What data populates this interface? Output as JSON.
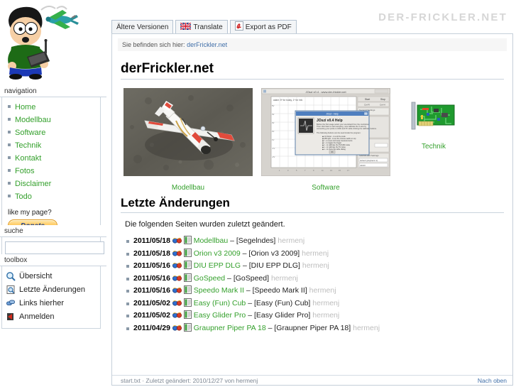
{
  "site": {
    "logo_text": "DER-FRICKLER.NET",
    "accent_green": "#34a02c",
    "link_blue": "#3f6ea8",
    "bullet_gray": "#8a99a8",
    "border_gray": "#c5cfd9"
  },
  "mascot": {
    "alt_name": "cartoon-boy-with-rc-transmitter-and-plane"
  },
  "tabs": [
    {
      "label": "Ältere Versionen",
      "icon": ""
    },
    {
      "label": "Translate",
      "icon": "uk-flag-icon"
    },
    {
      "label": "Export as PDF",
      "icon": "pdf-icon"
    }
  ],
  "breadcrumb": {
    "prefix": "Sie befinden sich hier:",
    "link": "derFrickler.net"
  },
  "page": {
    "title": "derFrickler.net",
    "changes_title": "Letzte Änderungen",
    "changes_intro": "Die folgenden Seiten wurden zuletzt geändert."
  },
  "sidebar": {
    "nav_head": "navigation",
    "nav_items": [
      {
        "label": "Home"
      },
      {
        "label": "Modellbau"
      },
      {
        "label": "Software"
      },
      {
        "label": "Technik"
      },
      {
        "label": "Kontakt"
      },
      {
        "label": "Fotos"
      },
      {
        "label": "Disclaimer"
      },
      {
        "label": "Todo"
      }
    ],
    "donate_prompt": "like my page?",
    "donate_label": "Donate",
    "search_head": "suche",
    "search_value": "",
    "search_placeholder": "",
    "toolbox_head": "toolbox",
    "toolbox_items": [
      {
        "label": "Übersicht",
        "icon": "magnifier-icon"
      },
      {
        "label": "Letzte Änderungen",
        "icon": "document-search-icon"
      },
      {
        "label": "Links hierher",
        "icon": "chain-links-icon"
      },
      {
        "label": "Anmelden",
        "icon": "login-arrow-icon"
      }
    ]
  },
  "thumbnails": [
    {
      "caption": "Modellbau",
      "kind": "rc-plane-photo"
    },
    {
      "caption": "Software",
      "kind": "joszi-screenshot",
      "dialog_title": "JOszi v0.4 Help"
    },
    {
      "caption": "Technik",
      "kind": "circuit-board-icon"
    }
  ],
  "changes": [
    {
      "date": "2011/05/18",
      "page": "Modellbau",
      "summary": "[Segelndes]",
      "author": "hermenj"
    },
    {
      "date": "2011/05/18",
      "page": "Orion v3 2009",
      "summary": "[Orion v3 2009]",
      "author": "hermenj"
    },
    {
      "date": "2011/05/16",
      "page": "DIU EPP DLG",
      "summary": "[DIU EPP DLG]",
      "author": "hermenj"
    },
    {
      "date": "2011/05/16",
      "page": "GoSpeed",
      "summary": "[GoSpeed]",
      "author": "hermenj"
    },
    {
      "date": "2011/05/16",
      "page": "Speedo Mark II",
      "summary": "[Speedo Mark II]",
      "author": "hermenj"
    },
    {
      "date": "2011/05/02",
      "page": "Easy (Fun) Cub",
      "summary": "[Easy (Fun) Cub]",
      "author": "hermenj"
    },
    {
      "date": "2011/05/02",
      "page": "Easy Glider Pro",
      "summary": "[Easy Glider Pro]",
      "author": "hermenj"
    },
    {
      "date": "2011/04/29",
      "page": "Graupner Piper PA 18",
      "summary": "[Graupner Piper PA 18]",
      "author": "hermenj"
    }
  ],
  "footer": {
    "left": "start.txt · Zuletzt geändert: 2010/12/27 von hermenj",
    "right": "Nach oben"
  }
}
